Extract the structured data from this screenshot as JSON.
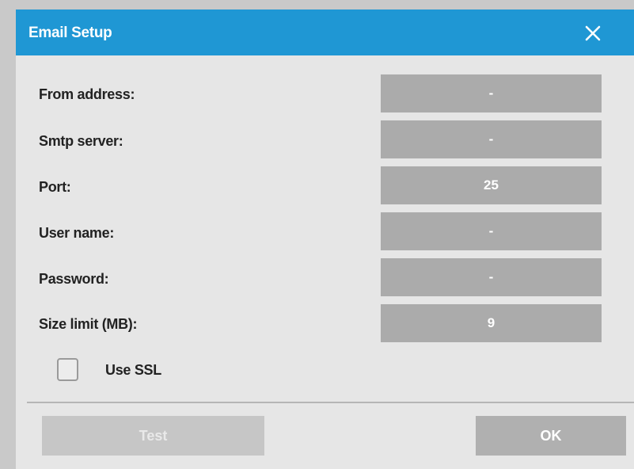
{
  "dialog": {
    "title": "Email Setup",
    "close_icon": "close-icon"
  },
  "fields": {
    "from_address": {
      "label": "From address:",
      "value": "-"
    },
    "smtp_server": {
      "label": "Smtp server:",
      "value": "-"
    },
    "port": {
      "label": "Port:",
      "value": "25"
    },
    "user_name": {
      "label": "User name:",
      "value": "-"
    },
    "password": {
      "label": "Password:",
      "value": "-"
    },
    "size_limit": {
      "label": "Size limit (MB):",
      "value": "9"
    }
  },
  "ssl": {
    "label": "Use SSL",
    "checked": false
  },
  "buttons": {
    "test_label": "Test",
    "test_enabled": false,
    "ok_label": "OK"
  },
  "colors": {
    "titlebar": "#1f97d4",
    "dialog_bg": "#e6e6e6",
    "field_bg": "#ababab",
    "button_bg": "#b0b0b0",
    "disabled_button_bg": "#c6c6c6"
  }
}
